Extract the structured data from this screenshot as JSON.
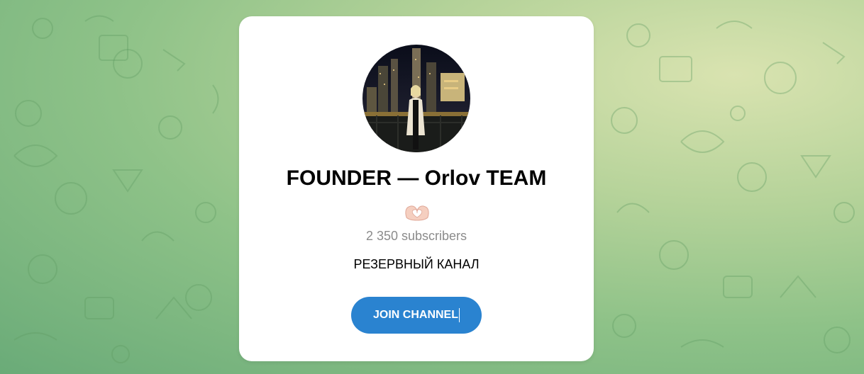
{
  "channel": {
    "title": "FOUNDER — Orlov TEAM",
    "emoji": "🫶🏻",
    "subscribers": "2 350 subscribers",
    "description": "РЕЗЕРВНЫЙ КАНАЛ",
    "join_label": "JOIN CHANNEL"
  },
  "colors": {
    "button": "#2a83d0",
    "subscribers_text": "#8b8b8b",
    "card": "#ffffff"
  },
  "icons": {
    "background": "doodle-pattern",
    "avatar": "channel-avatar-photo",
    "emoji": "heart-hands-icon"
  }
}
